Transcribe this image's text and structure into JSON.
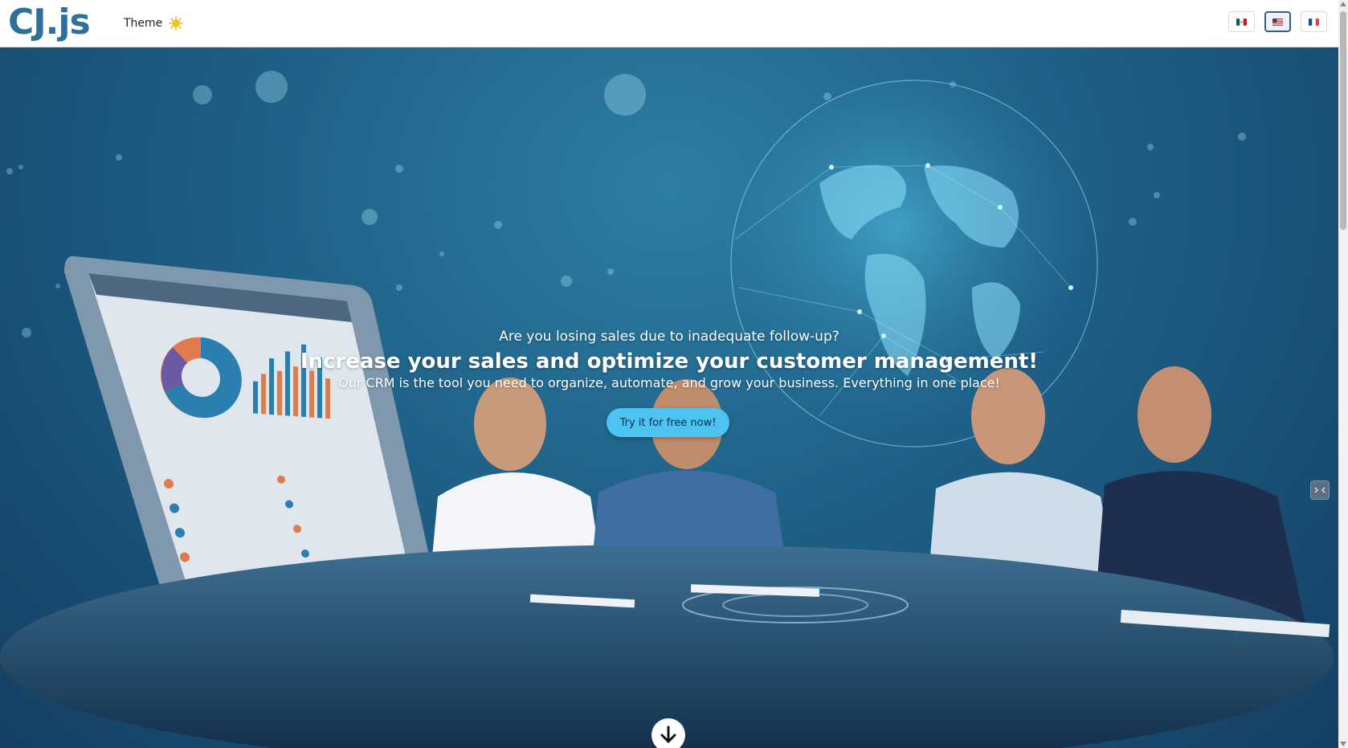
{
  "header": {
    "logo_text": "CJ.js",
    "theme_label": "Theme",
    "theme_icon": "sun-icon",
    "languages": [
      {
        "code": "es-MX",
        "icon": "mexico-flag-icon",
        "active": false
      },
      {
        "code": "en-US",
        "icon": "usa-flag-icon",
        "active": true
      },
      {
        "code": "fr",
        "icon": "france-flag-icon",
        "active": false
      }
    ]
  },
  "hero": {
    "question": "Are you losing sales due to inadequate follow-up?",
    "title": "Increase your sales and optimize your customer management!",
    "subtitle": "Our CRM is the tool you need to organize, automate, and grow your business. Everything in one place!",
    "cta_label": "Try it for free now!",
    "scroll_icon": "arrow-down-icon"
  },
  "colors": {
    "brand": "#2e6f9c",
    "cta_background": "#4cc3f0",
    "hero_background": "#1e5f86"
  }
}
